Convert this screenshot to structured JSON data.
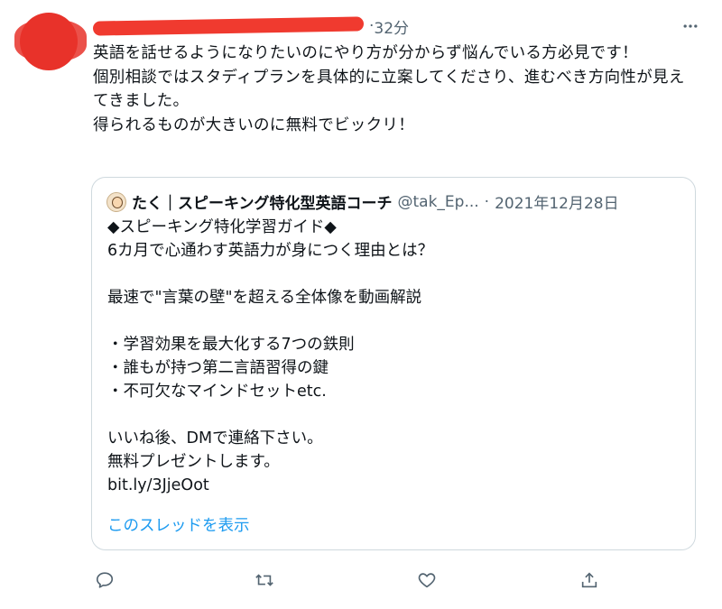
{
  "tweet": {
    "time": "32分",
    "separator": "·",
    "text": "英語を話せるようになりたいのにやり方が分からず悩んでいる方必見です！\n個別相談ではスタディプランを具体的に立案してくださり、進むべき方向性が見えてきました。\n得られるものが大きいのに無料でビックリ！"
  },
  "quote": {
    "name": "たく｜スピーキング特化型英語コーチ",
    "handle": "@tak_Ep...",
    "separator": "·",
    "date": "2021年12月28日",
    "body": "◆スピーキング特化学習ガイド◆\n6カ月で心通わす英語力が身につく理由とは？\n\n最速で\"言葉の壁\"を超える全体像を動画解説\n\n・学習効果を最大化する7つの鉄則\n・誰もが持つ第二言語習得の鍵\n・不可欠なマインドセットetc.\n\nいいね後、DMで連絡下さい。\n無料プレゼントします。\nbit.ly/3JjeOot",
    "thread_link": "このスレッドを表示"
  },
  "actions": {
    "icons": [
      "reply-icon",
      "retweet-icon",
      "like-icon",
      "share-icon"
    ]
  },
  "colors": {
    "link": "#1d9bf0",
    "muted": "#536471",
    "border": "#cfd9de",
    "redaction": "#f03a2f"
  }
}
